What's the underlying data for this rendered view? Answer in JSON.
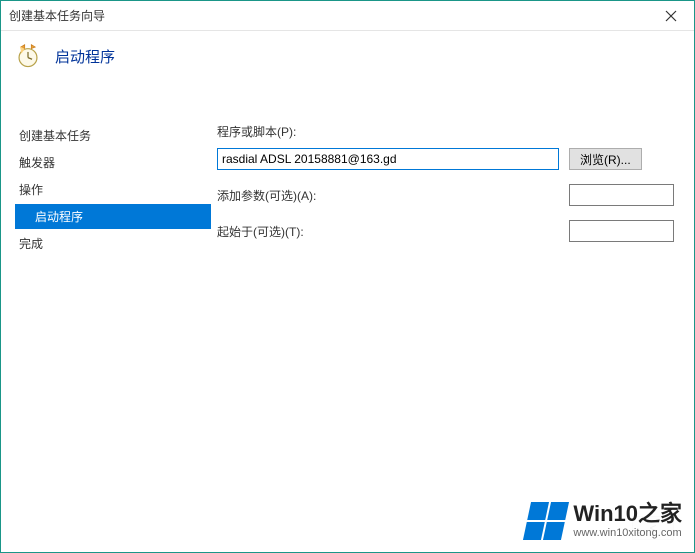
{
  "titlebar": {
    "title": "创建基本任务向导"
  },
  "header": {
    "title": "启动程序"
  },
  "sidebar": {
    "items": [
      {
        "label": "创建基本任务"
      },
      {
        "label": "触发器"
      },
      {
        "label": "操作"
      },
      {
        "label": "启动程序"
      },
      {
        "label": "完成"
      }
    ]
  },
  "form": {
    "program_label": "程序或脚本(P):",
    "program_value": "rasdial ADSL 20158881@163.gd",
    "browse": "浏览(R)...",
    "args_label": "添加参数(可选)(A):",
    "args_value": "",
    "startin_label": "起始于(可选)(T):",
    "startin_value": ""
  },
  "footer": {
    "back": "<"
  },
  "watermark": {
    "title": "Win10之家",
    "url": "www.win10xitong.com"
  }
}
